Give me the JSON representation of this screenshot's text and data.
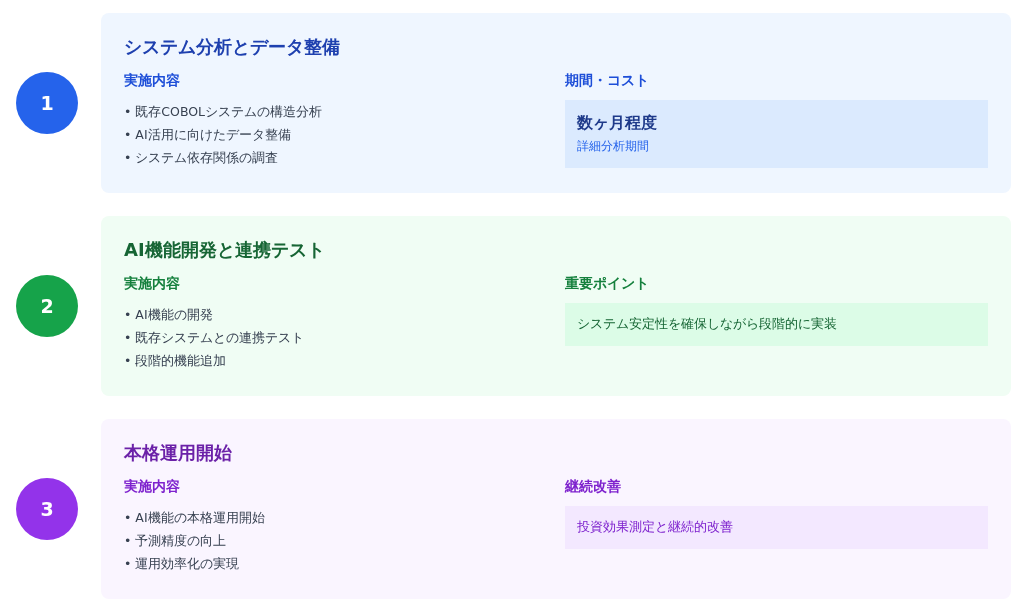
{
  "phases": [
    {
      "number": "1",
      "color": "#2563eb",
      "title": "システム分析とデータ整備",
      "content_heading": "実施内容",
      "items": [
        "• 既存COBOLシステムの構造分析",
        "• AI活用に向けたデータ整備",
        "• システム依存関係の調査"
      ],
      "side_heading": "期間・コスト",
      "side": {
        "kind": "cost",
        "headline": "数ヶ月程度",
        "sub": "詳細分析期間"
      }
    },
    {
      "number": "2",
      "color": "#16a34a",
      "title": "AI機能開発と連携テスト",
      "content_heading": "実施内容",
      "items": [
        "• AI機能の開発",
        "• 既存システムとの連携テスト",
        "• 段階的機能追加"
      ],
      "side_heading": "重要ポイント",
      "side": {
        "kind": "note",
        "text": "システム安定性を確保しながら段階的に実装"
      }
    },
    {
      "number": "3",
      "color": "#9333ea",
      "title": "本格運用開始",
      "content_heading": "実施内容",
      "items": [
        "• AI機能の本格運用開始",
        "• 予測精度の向上",
        "• 運用効率化の実現"
      ],
      "side_heading": "継続改善",
      "side": {
        "kind": "note",
        "text": "投資効果測定と継続的改善"
      }
    }
  ]
}
